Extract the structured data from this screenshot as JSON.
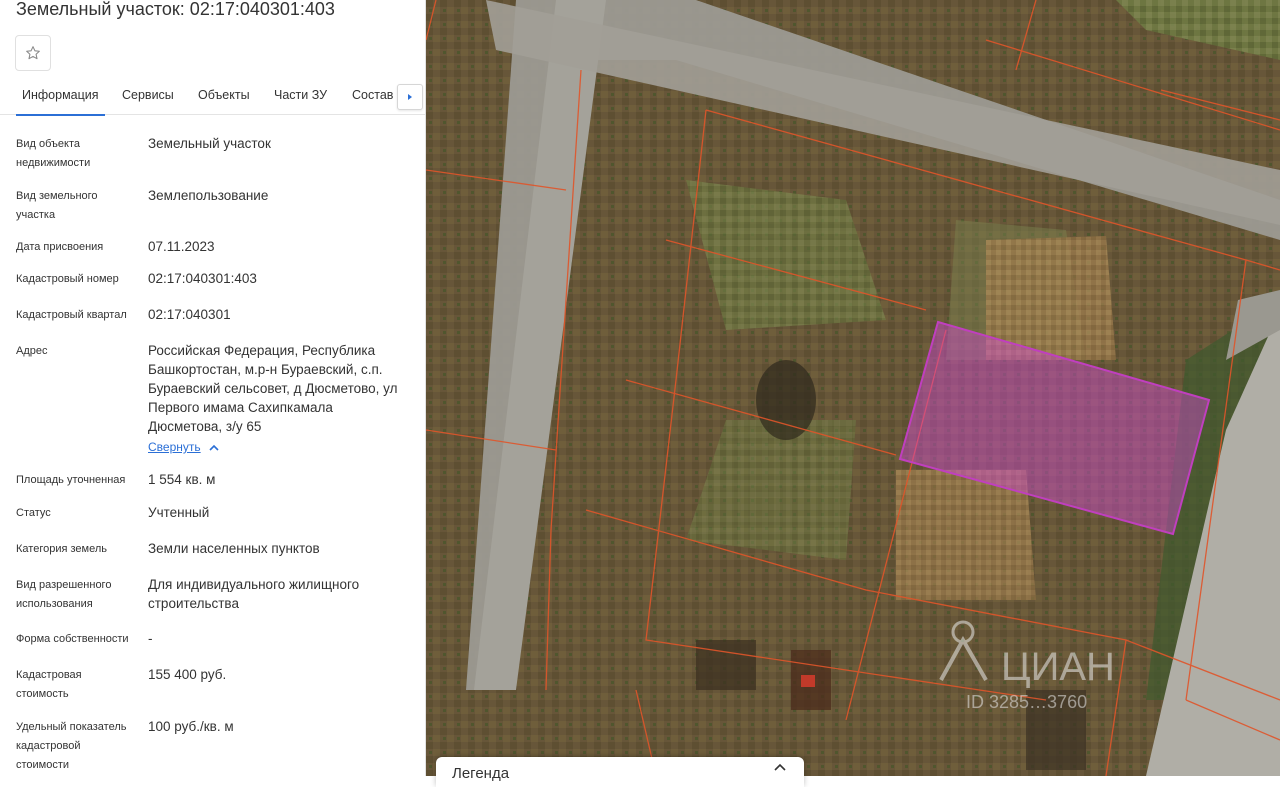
{
  "panel": {
    "title": "Земельный участок: 02:17:040301:403",
    "favorite_icon": "star-icon",
    "tabs": [
      "Информация",
      "Сервисы",
      "Объекты",
      "Части ЗУ",
      "Состав"
    ],
    "active_tab": "Информация",
    "tab_next_icon": "chevron-right-icon",
    "fields": {
      "object_type": {
        "label": "Вид объекта недвижимости",
        "value": "Земельный участок"
      },
      "land_type": {
        "label": "Вид земельного участка",
        "value": "Землепользование"
      },
      "assign_date": {
        "label": "Дата присвоения",
        "value": "07.11.2023"
      },
      "cadastral_number": {
        "label": "Кадастровый номер",
        "value": "02:17:040301:403"
      },
      "cadastral_quarter": {
        "label": "Кадастровый квартал",
        "value": "02:17:040301"
      },
      "address": {
        "label": "Адрес",
        "value": "Российская Федерация, Республика Башкортостан, м.р-н Бураевский, с.п. Бураевский сельсовет, д Дюсметово, ул Первого имама Сахипкамала Дюсметова, з/у 65"
      },
      "area": {
        "label": "Площадь уточненная",
        "value": "1 554 кв. м"
      },
      "status": {
        "label": "Статус",
        "value": "Учтенный"
      },
      "land_category": {
        "label": "Категория земель",
        "value": "Земли населенных пунктов"
      },
      "permitted_use": {
        "label": "Вид разрешенного использования",
        "value": "Для индивидуального жилищного строительства"
      },
      "ownership": {
        "label": "Форма собственности",
        "value": "-"
      },
      "cadastral_value": {
        "label": "Кадастровая стоимость",
        "value": "155 400 руб."
      },
      "specific_value": {
        "label": "Удельный показатель кадастровой стоимости",
        "value": "100 руб./кв. м"
      }
    },
    "collapse_link": "Свернуть",
    "collapse_icon": "chevron-up-icon"
  },
  "map": {
    "parcel_color": "#c03fbf",
    "boundary_color": "#e0552a",
    "watermark_text": "ЦИАН",
    "watermark_id": "ID 3285…3760"
  },
  "legend": {
    "title": "Легенда",
    "toggle_icon": "chevron-up-icon"
  }
}
